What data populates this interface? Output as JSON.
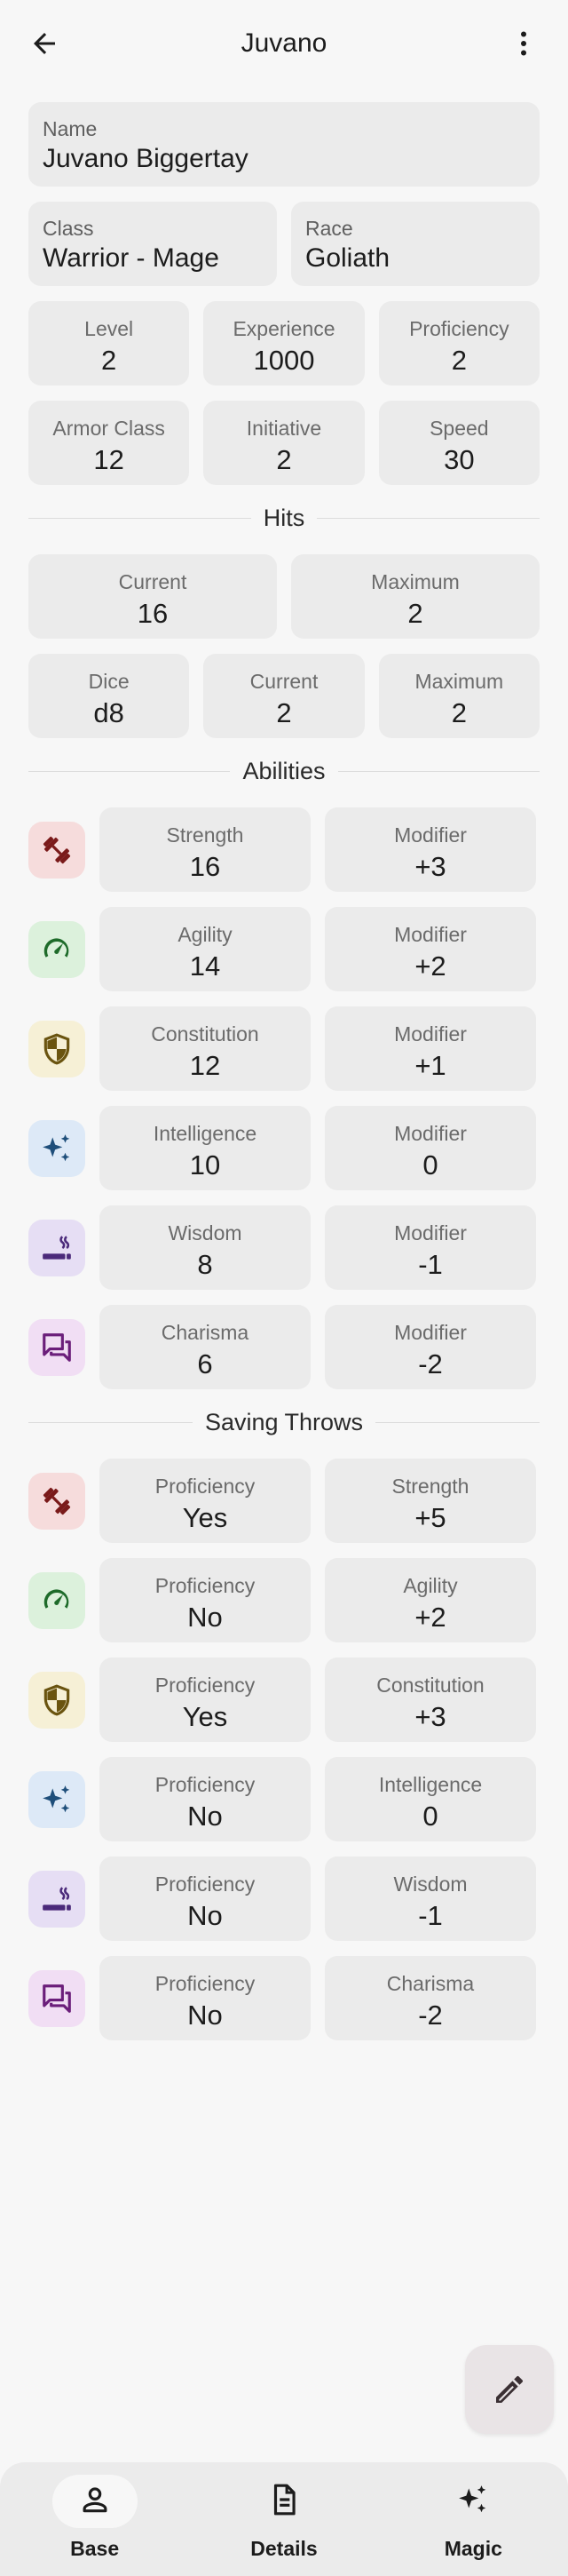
{
  "appbar": {
    "title": "Juvano"
  },
  "character": {
    "name": {
      "label": "Name",
      "value": "Juvano Biggertay"
    },
    "class": {
      "label": "Class",
      "value": "Warrior - Mage"
    },
    "race": {
      "label": "Race",
      "value": "Goliath"
    },
    "level": {
      "label": "Level",
      "value": "2"
    },
    "experience": {
      "label": "Experience",
      "value": "1000"
    },
    "proficiency": {
      "label": "Proficiency",
      "value": "2"
    },
    "armor_class": {
      "label": "Armor Class",
      "value": "12"
    },
    "initiative": {
      "label": "Initiative",
      "value": "2"
    },
    "speed": {
      "label": "Speed",
      "value": "30"
    }
  },
  "hits": {
    "title": "Hits",
    "current": {
      "label": "Current",
      "value": "16"
    },
    "maximum": {
      "label": "Maximum",
      "value": "2"
    },
    "dice": {
      "label": "Dice",
      "value": "d8"
    },
    "dice_current": {
      "label": "Current",
      "value": "2"
    },
    "dice_maximum": {
      "label": "Maximum",
      "value": "2"
    }
  },
  "abilities": {
    "title": "Abilities",
    "items": [
      {
        "icon": "dumbbell-icon",
        "name": "Strength",
        "value": "16",
        "mod_label": "Modifier",
        "modifier": "+3",
        "icon_bg": "#f6dcdc",
        "icon_color": "#7a1a1a"
      },
      {
        "icon": "speedometer-icon",
        "name": "Agility",
        "value": "14",
        "mod_label": "Modifier",
        "modifier": "+2",
        "icon_bg": "#dcf1dc",
        "icon_color": "#1e6b2a"
      },
      {
        "icon": "shield-icon",
        "name": "Constitution",
        "value": "12",
        "mod_label": "Modifier",
        "modifier": "+1",
        "icon_bg": "#f6f0d6",
        "icon_color": "#6a5410"
      },
      {
        "icon": "sparkles-icon",
        "name": "Intelligence",
        "value": "10",
        "mod_label": "Modifier",
        "modifier": "0",
        "icon_bg": "#dde9f7",
        "icon_color": "#1e4e7a"
      },
      {
        "icon": "pipe-icon",
        "name": "Wisdom",
        "value": "8",
        "mod_label": "Modifier",
        "modifier": "-1",
        "icon_bg": "#e6def4",
        "icon_color": "#4b2a7a"
      },
      {
        "icon": "chat-icon",
        "name": "Charisma",
        "value": "6",
        "mod_label": "Modifier",
        "modifier": "-2",
        "icon_bg": "#f1def4",
        "icon_color": "#6b1e7a"
      }
    ]
  },
  "saving_throws": {
    "title": "Saving Throws",
    "items": [
      {
        "icon": "dumbbell-icon",
        "prof_label": "Proficiency",
        "proficiency": "Yes",
        "name": "Strength",
        "value": "+5",
        "icon_bg": "#f6dcdc",
        "icon_color": "#7a1a1a"
      },
      {
        "icon": "speedometer-icon",
        "prof_label": "Proficiency",
        "proficiency": "No",
        "name": "Agility",
        "value": "+2",
        "icon_bg": "#dcf1dc",
        "icon_color": "#1e6b2a"
      },
      {
        "icon": "shield-icon",
        "prof_label": "Proficiency",
        "proficiency": "Yes",
        "name": "Constitution",
        "value": "+3",
        "icon_bg": "#f6f0d6",
        "icon_color": "#6a5410"
      },
      {
        "icon": "sparkles-icon",
        "prof_label": "Proficiency",
        "proficiency": "No",
        "name": "Intelligence",
        "value": "0",
        "icon_bg": "#dde9f7",
        "icon_color": "#1e4e7a"
      },
      {
        "icon": "pipe-icon",
        "prof_label": "Proficiency",
        "proficiency": "No",
        "name": "Wisdom",
        "value": "-1",
        "icon_bg": "#e6def4",
        "icon_color": "#4b2a7a"
      },
      {
        "icon": "chat-icon",
        "prof_label": "Proficiency",
        "proficiency": "No",
        "name": "Charisma",
        "value": "-2",
        "icon_bg": "#f1def4",
        "icon_color": "#6b1e7a"
      }
    ]
  },
  "fab": {
    "icon": "pencil-icon"
  },
  "nav": {
    "items": [
      {
        "label": "Base",
        "icon": "person-icon",
        "active": true
      },
      {
        "label": "Details",
        "icon": "document-icon",
        "active": false
      },
      {
        "label": "Magic",
        "icon": "sparkles-icon",
        "active": false
      }
    ]
  }
}
